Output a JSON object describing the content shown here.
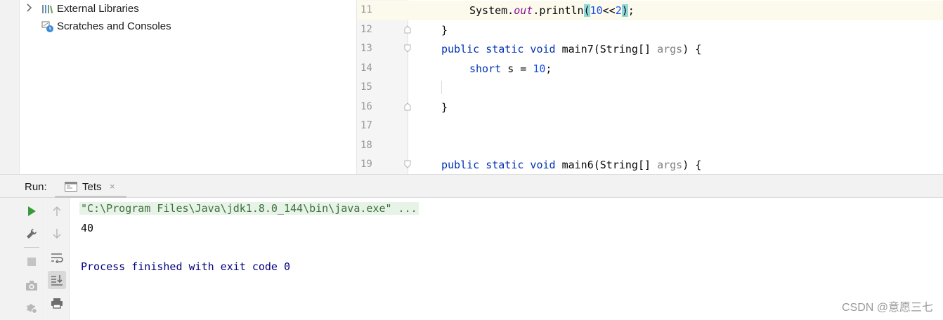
{
  "project_tree": {
    "items": [
      {
        "label": "External Libraries",
        "icon": "library-icon",
        "expandable": true
      },
      {
        "label": "Scratches and Consoles",
        "icon": "scratches-icon",
        "expandable": false
      }
    ]
  },
  "editor": {
    "lines": [
      {
        "num": "11"
      },
      {
        "num": "12"
      },
      {
        "num": "13"
      },
      {
        "num": "14"
      },
      {
        "num": "15"
      },
      {
        "num": "16"
      },
      {
        "num": "17"
      },
      {
        "num": "18"
      },
      {
        "num": "19"
      }
    ],
    "code": {
      "l11_system": "System.",
      "l11_out": "out",
      "l11_println": ".println",
      "l11_paren_open": "(",
      "l11_num1": "10",
      "l11_shift": "<<",
      "l11_num2": "2",
      "l11_paren_close": ")",
      "l11_semi": ";",
      "l12": "}",
      "l13_kw": "public static void ",
      "l13_name": "main7(String[] ",
      "l13_param": "args",
      "l13_end": ") {",
      "l14_kw": "short ",
      "l14_var": "s = ",
      "l14_num": "10",
      "l14_semi": ";",
      "l16": "}",
      "l19_kw": "public static void ",
      "l19_name": "main6(String[] ",
      "l19_param": "args",
      "l19_end": ") {"
    }
  },
  "run_panel": {
    "label": "Run:",
    "tab_label": "Tets",
    "tab_close": "×",
    "console": {
      "command": "\"C:\\Program Files\\Java\\jdk1.8.0_144\\bin\\java.exe\" ...",
      "output": "40",
      "exit_message": "Process finished with exit code 0"
    }
  },
  "watermark": "CSDN @意愿三七",
  "colors": {
    "keyword": "#0033b3",
    "number": "#1750eb",
    "static_field": "#871094",
    "brace_match": "#93d9d9",
    "exit_text": "#000080",
    "run_green": "#3a9a3a"
  }
}
